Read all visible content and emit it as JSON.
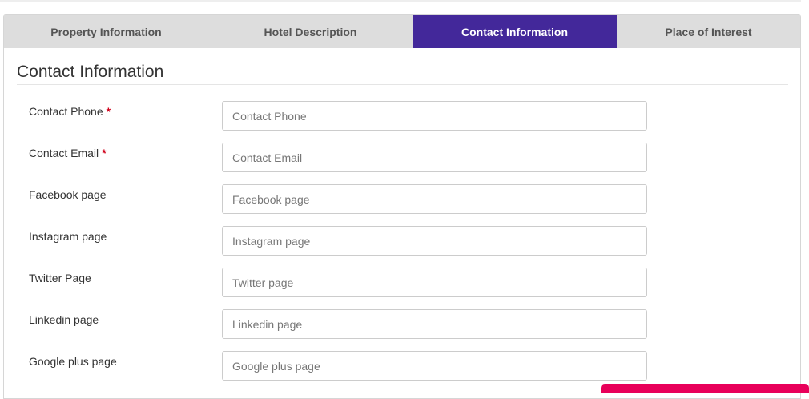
{
  "tabs": [
    {
      "label": "Property Information"
    },
    {
      "label": "Hotel Description"
    },
    {
      "label": "Contact Information"
    },
    {
      "label": "Place of Interest"
    }
  ],
  "active_tab": "Contact Information",
  "section": {
    "title": "Contact Information"
  },
  "fields": [
    {
      "label": "Contact Phone",
      "required": "*",
      "placeholder": "Contact Phone",
      "value": ""
    },
    {
      "label": "Contact Email",
      "required": "*",
      "placeholder": "Contact Email",
      "value": ""
    },
    {
      "label": "Facebook page",
      "placeholder": "Facebook page",
      "value": ""
    },
    {
      "label": "Instagram page",
      "placeholder": "Instagram page",
      "value": ""
    },
    {
      "label": "Twitter Page",
      "placeholder": "Twitter page",
      "value": ""
    },
    {
      "label": "Linkedin page",
      "placeholder": "Linkedin page",
      "value": ""
    },
    {
      "label": "Google plus page",
      "placeholder": "Google plus page",
      "value": ""
    }
  ],
  "colors": {
    "active_tab_bg": "#43289a",
    "tab_bar_bg": "#dddddd",
    "required_star": "#d0021b",
    "floating_bar": "#e8005a"
  }
}
